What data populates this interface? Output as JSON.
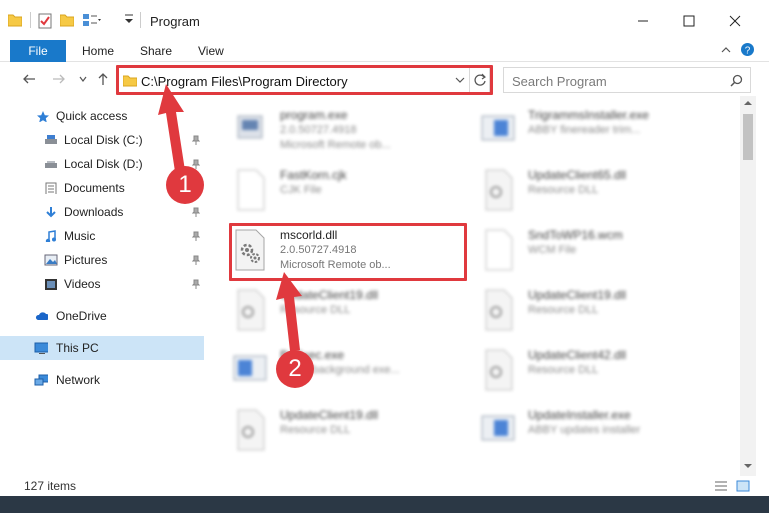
{
  "window": {
    "title": "Program"
  },
  "ribbon": {
    "tabs": [
      "File",
      "Home",
      "Share",
      "View"
    ]
  },
  "nav": {
    "address": "C:\\Program Files\\Program Directory",
    "search_placeholder": "Search Program"
  },
  "sidebar": {
    "quick_access": "Quick access",
    "items": [
      {
        "label": "Local Disk (C:)"
      },
      {
        "label": "Local Disk (D:)"
      },
      {
        "label": "Documents"
      },
      {
        "label": "Downloads"
      },
      {
        "label": "Music"
      },
      {
        "label": "Pictures"
      },
      {
        "label": "Videos"
      }
    ],
    "onedrive": "OneDrive",
    "thispc": "This PC",
    "network": "Network"
  },
  "files": [
    {
      "name": "program.exe",
      "line1": "2.0.50727.4918",
      "line2": "Microsoft Remote ob..."
    },
    {
      "name": "TrigrammsInstaller.exe",
      "line1": "ABBY finereader trim...",
      "line2": ""
    },
    {
      "name": "FastKorn.cjk",
      "line1": "CJK File",
      "line2": ""
    },
    {
      "name": "UpdateClient65.dll",
      "line1": "Resource DLL",
      "line2": ""
    },
    {
      "name": "mscorld.dll",
      "line1": "2.0.50727.4918",
      "line2": "Microsoft Remote ob..."
    },
    {
      "name": "SndToWP16.wcm",
      "line1": "WCM File",
      "line2": ""
    },
    {
      "name": "UpdateClient19.dll",
      "line1": "Resource DLL",
      "line2": ""
    },
    {
      "name": "UpdateClient19.dll",
      "line1": "Resource DLL",
      "line2": ""
    },
    {
      "name": "BgExec.exe",
      "line1": "ABBY background exe...",
      "line2": ""
    },
    {
      "name": "UpdateClient42.dll",
      "line1": "Resource DLL",
      "line2": ""
    },
    {
      "name": "UpdateClient19.dll",
      "line1": "Resource DLL",
      "line2": ""
    },
    {
      "name": "UpdateInstaller.exe",
      "line1": "ABBY updates installer",
      "line2": ""
    }
  ],
  "status": {
    "count": "127 items"
  },
  "annotations": {
    "step1": "1",
    "step2": "2"
  },
  "colors": {
    "accent": "#1979ca",
    "highlight": "#e0393e",
    "selection": "#cce4f7"
  }
}
